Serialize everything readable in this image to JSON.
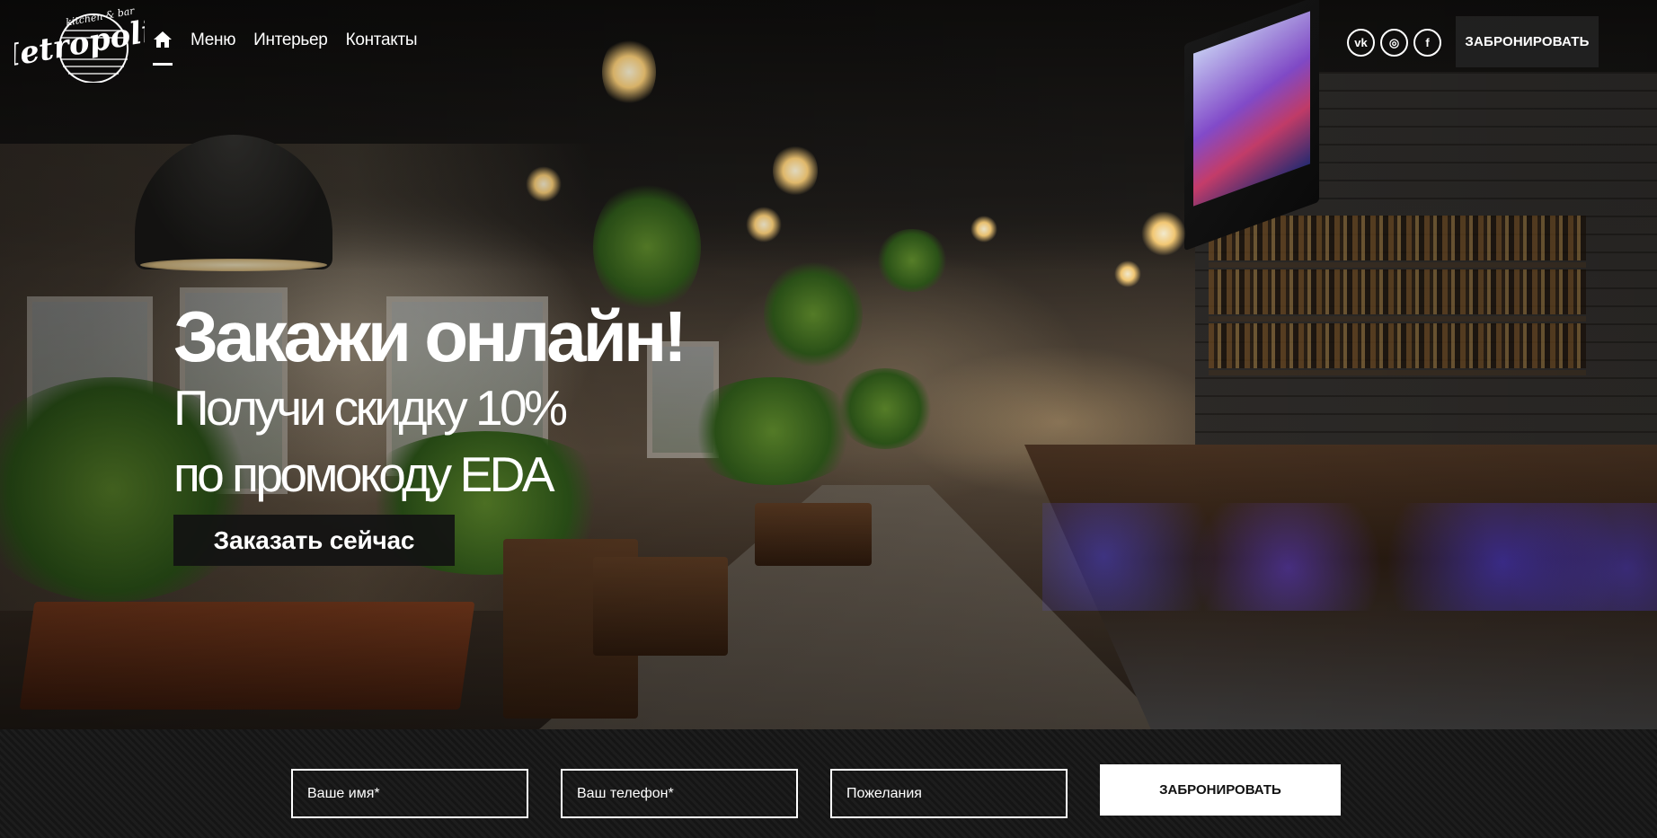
{
  "brand": {
    "logo_text": "Metropolis",
    "logo_tagline": "kitchen & bar",
    "logo_icon": "metropolis-logo"
  },
  "nav": {
    "home_icon": "home-icon",
    "items": [
      "Меню",
      "Интерьер",
      "Контакты"
    ]
  },
  "social": [
    {
      "name": "vk-icon",
      "glyph": "vk"
    },
    {
      "name": "instagram-icon",
      "glyph": "◎"
    },
    {
      "name": "facebook-icon",
      "glyph": "f"
    }
  ],
  "header": {
    "book_label": "ЗАБРОНИРОВАТЬ"
  },
  "hero": {
    "headline": "Закажи онлайн!",
    "subline1": "Получи скидку 10%",
    "subline2": "по промокоду EDA",
    "cta_label": "Заказать сейчас"
  },
  "booking": {
    "name_placeholder": "Ваше имя*",
    "phone_placeholder": "Ваш телефон*",
    "wishes_placeholder": "Пожелания",
    "submit_label": "ЗАБРОНИРОВАТЬ"
  },
  "colors": {
    "accent": "#ffffff",
    "dark_button": "#1e1e1e"
  }
}
